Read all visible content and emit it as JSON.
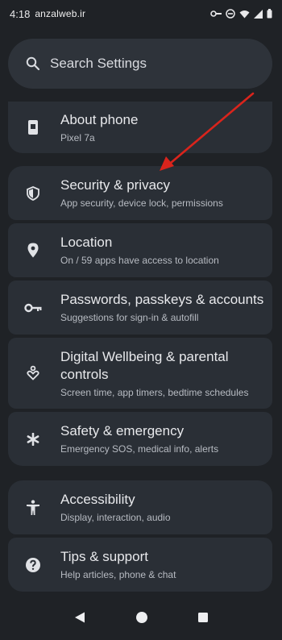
{
  "status": {
    "time": "4:18",
    "watermark": "anzalweb.ir"
  },
  "search": {
    "placeholder": "Search Settings",
    "icon": "search-icon"
  },
  "about": {
    "title": "About phone",
    "subtitle": "Pixel 7a",
    "icon": "phone-icon"
  },
  "items": [
    {
      "title": "Security & privacy",
      "subtitle": "App security, device lock, permissions",
      "icon": "shield-icon"
    },
    {
      "title": "Location",
      "subtitle": "On / 59 apps have access to location",
      "icon": "location-pin-icon"
    },
    {
      "title": "Passwords, passkeys & accounts",
      "subtitle": "Suggestions for sign-in & autofill",
      "icon": "key-icon"
    },
    {
      "title": "Digital Wellbeing & parental controls",
      "subtitle": "Screen time, app timers, bedtime schedules",
      "icon": "wellbeing-icon"
    },
    {
      "title": "Safety & emergency",
      "subtitle": "Emergency SOS, medical info, alerts",
      "icon": "asterisk-icon"
    }
  ],
  "items2": [
    {
      "title": "Accessibility",
      "subtitle": "Display, interaction, audio",
      "icon": "accessibility-icon"
    },
    {
      "title": "Tips & support",
      "subtitle": "Help articles, phone & chat",
      "icon": "help-icon"
    }
  ],
  "colors": {
    "background": "#1f2226",
    "card": "#2a2f36",
    "annotation_arrow": "#d9241c"
  }
}
